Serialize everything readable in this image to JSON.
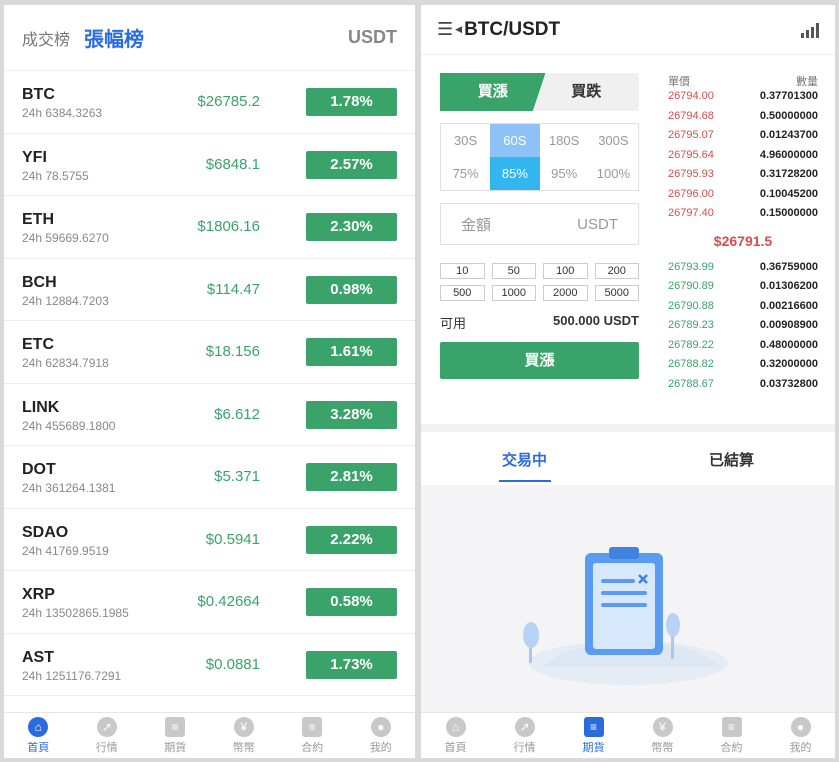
{
  "left": {
    "tabs": {
      "volume": "成交榜",
      "gainers": "張幅榜"
    },
    "quote_unit": "USDT",
    "markets": [
      {
        "symbol": "BTC",
        "volume": "24h 6384.3263",
        "price": "$26785.2",
        "change": "1.78%"
      },
      {
        "symbol": "YFI",
        "volume": "24h 78.5755",
        "price": "$6848.1",
        "change": "2.57%"
      },
      {
        "symbol": "ETH",
        "volume": "24h 59669.6270",
        "price": "$1806.16",
        "change": "2.30%"
      },
      {
        "symbol": "BCH",
        "volume": "24h 12884.7203",
        "price": "$114.47",
        "change": "0.98%"
      },
      {
        "symbol": "ETC",
        "volume": "24h 62834.7918",
        "price": "$18.156",
        "change": "1.61%"
      },
      {
        "symbol": "LINK",
        "volume": "24h 455689.1800",
        "price": "$6.612",
        "change": "3.28%"
      },
      {
        "symbol": "DOT",
        "volume": "24h 361264.1381",
        "price": "$5.371",
        "change": "2.81%"
      },
      {
        "symbol": "SDAO",
        "volume": "24h 41769.9519",
        "price": "$0.5941",
        "change": "2.22%"
      },
      {
        "symbol": "XRP",
        "volume": "24h 13502865.1985",
        "price": "$0.42664",
        "change": "0.58%"
      },
      {
        "symbol": "AST",
        "volume": "24h 1251176.7291",
        "price": "$0.0881",
        "change": "1.73%"
      }
    ]
  },
  "nav": [
    {
      "label": "首頁",
      "icon": "home-icon",
      "glyph": "⌂"
    },
    {
      "label": "行情",
      "icon": "chart-icon",
      "glyph": "↗"
    },
    {
      "label": "期貨",
      "icon": "document-icon",
      "glyph": "≡"
    },
    {
      "label": "幣幣",
      "icon": "yen-icon",
      "glyph": "¥"
    },
    {
      "label": "合約",
      "icon": "contract-icon",
      "glyph": "≡"
    },
    {
      "label": "我的",
      "icon": "user-icon",
      "glyph": "●"
    }
  ],
  "right": {
    "pair": "BTC/USDT",
    "buy_long": "買漲",
    "buy_short": "買跌",
    "times": [
      "30S",
      "60S",
      "180S",
      "300S"
    ],
    "rates": [
      "75%",
      "85%",
      "95%",
      "100%"
    ],
    "amount_placeholder": "金額",
    "amount_unit": "USDT",
    "quick_amounts": [
      "10",
      "50",
      "100",
      "200",
      "500",
      "1000",
      "2000",
      "5000"
    ],
    "available_label": "可用",
    "available_value": "500.000 USDT",
    "submit_label": "買漲",
    "book": {
      "price_header": "單價",
      "qty_header": "數量",
      "asks": [
        {
          "p": "26794.00",
          "q": "0.37701300"
        },
        {
          "p": "26794.68",
          "q": "0.50000000"
        },
        {
          "p": "26795.07",
          "q": "0.01243700"
        },
        {
          "p": "26795.64",
          "q": "4.96000000"
        },
        {
          "p": "26795.93",
          "q": "0.31728200"
        },
        {
          "p": "26796.00",
          "q": "0.10045200"
        },
        {
          "p": "26797.40",
          "q": "0.15000000"
        }
      ],
      "last_price": "$26791.5",
      "bids": [
        {
          "p": "26793.99",
          "q": "0.36759000"
        },
        {
          "p": "26790.89",
          "q": "0.01306200"
        },
        {
          "p": "26790.88",
          "q": "0.00216600"
        },
        {
          "p": "26789.23",
          "q": "0.00908900"
        },
        {
          "p": "26789.22",
          "q": "0.48000000"
        },
        {
          "p": "26788.82",
          "q": "0.32000000"
        },
        {
          "p": "26788.67",
          "q": "0.03732800"
        }
      ]
    },
    "order_tabs": {
      "open": "交易中",
      "settled": "已結算"
    }
  }
}
